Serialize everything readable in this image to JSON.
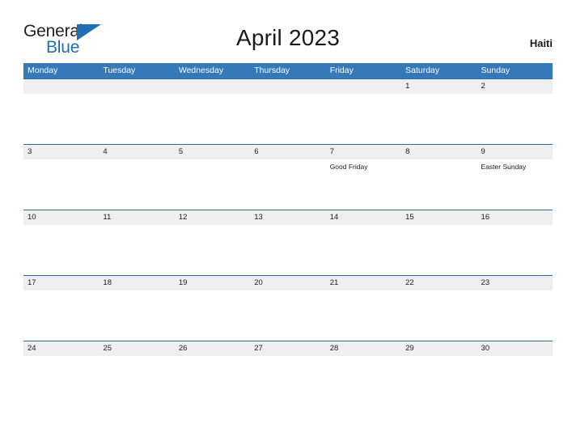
{
  "brand": {
    "name_dark": "General",
    "name_blue": "Blue",
    "flag_icon": "blue-triangle-flag-icon",
    "dark_color": "#231f20",
    "blue_color": "#1f6fb4"
  },
  "header": {
    "title": "April 2023",
    "country": "Haiti"
  },
  "theme": {
    "header_blue": "#3579b9",
    "row_line_blue": "#2e6da4",
    "date_band_gray": "#efefef",
    "text_dark": "#1a1a1a"
  },
  "calendar": {
    "weekdays": [
      "Monday",
      "Tuesday",
      "Wednesday",
      "Thursday",
      "Friday",
      "Saturday",
      "Sunday"
    ],
    "weeks": [
      [
        {
          "date": "",
          "event": ""
        },
        {
          "date": "",
          "event": ""
        },
        {
          "date": "",
          "event": ""
        },
        {
          "date": "",
          "event": ""
        },
        {
          "date": "",
          "event": ""
        },
        {
          "date": "1",
          "event": ""
        },
        {
          "date": "2",
          "event": ""
        }
      ],
      [
        {
          "date": "3",
          "event": ""
        },
        {
          "date": "4",
          "event": ""
        },
        {
          "date": "5",
          "event": ""
        },
        {
          "date": "6",
          "event": ""
        },
        {
          "date": "7",
          "event": "Good Friday"
        },
        {
          "date": "8",
          "event": ""
        },
        {
          "date": "9",
          "event": "Easter Sunday"
        }
      ],
      [
        {
          "date": "10",
          "event": ""
        },
        {
          "date": "11",
          "event": ""
        },
        {
          "date": "12",
          "event": ""
        },
        {
          "date": "13",
          "event": ""
        },
        {
          "date": "14",
          "event": ""
        },
        {
          "date": "15",
          "event": ""
        },
        {
          "date": "16",
          "event": ""
        }
      ],
      [
        {
          "date": "17",
          "event": ""
        },
        {
          "date": "18",
          "event": ""
        },
        {
          "date": "19",
          "event": ""
        },
        {
          "date": "20",
          "event": ""
        },
        {
          "date": "21",
          "event": ""
        },
        {
          "date": "22",
          "event": ""
        },
        {
          "date": "23",
          "event": ""
        }
      ],
      [
        {
          "date": "24",
          "event": ""
        },
        {
          "date": "25",
          "event": ""
        },
        {
          "date": "26",
          "event": ""
        },
        {
          "date": "27",
          "event": ""
        },
        {
          "date": "28",
          "event": ""
        },
        {
          "date": "29",
          "event": ""
        },
        {
          "date": "30",
          "event": ""
        }
      ]
    ]
  }
}
